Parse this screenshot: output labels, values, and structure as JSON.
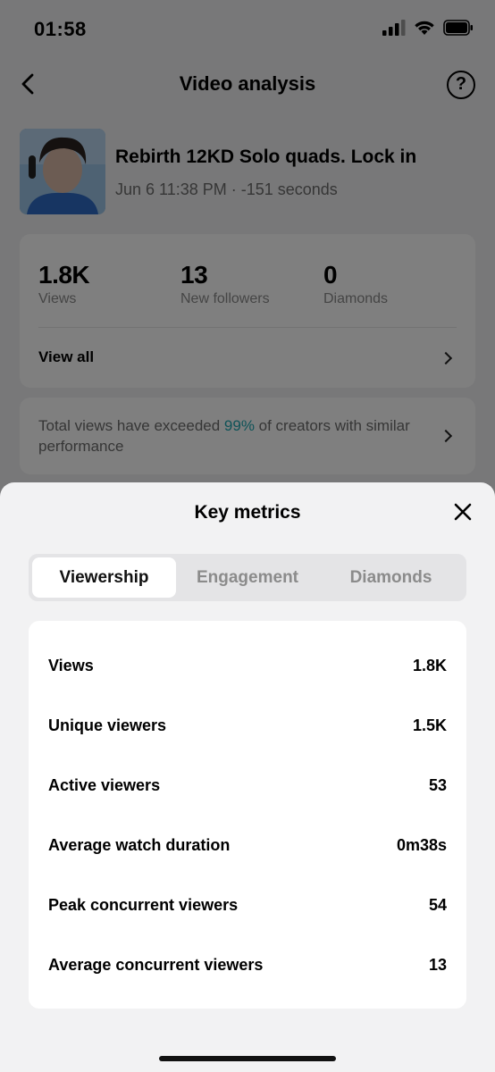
{
  "status_bar": {
    "time": "01:58"
  },
  "header": {
    "title": "Video analysis",
    "help_label": "?"
  },
  "video": {
    "title": "Rebirth 12KD Solo quads. Lock in",
    "meta": "Jun 6 11:38 PM · -151 seconds"
  },
  "stats": [
    {
      "value": "1.8K",
      "label": "Views"
    },
    {
      "value": "13",
      "label": "New followers"
    },
    {
      "value": "0",
      "label": "Diamonds"
    }
  ],
  "view_all_label": "View all",
  "info": {
    "prefix": "Total views have exceeded ",
    "highlight": "99%",
    "suffix": " of creators with similar performance",
    "highlight_color": "#1ea7b0"
  },
  "sheet": {
    "title": "Key metrics",
    "tabs": [
      {
        "label": "Viewership",
        "active": true
      },
      {
        "label": "Engagement",
        "active": false
      },
      {
        "label": "Diamonds",
        "active": false
      }
    ],
    "metrics": [
      {
        "label": "Views",
        "value": "1.8K"
      },
      {
        "label": "Unique viewers",
        "value": "1.5K"
      },
      {
        "label": "Active viewers",
        "value": "53"
      },
      {
        "label": "Average watch duration",
        "value": "0m38s"
      },
      {
        "label": "Peak concurrent viewers",
        "value": "54"
      },
      {
        "label": "Average concurrent viewers",
        "value": "13"
      }
    ]
  }
}
